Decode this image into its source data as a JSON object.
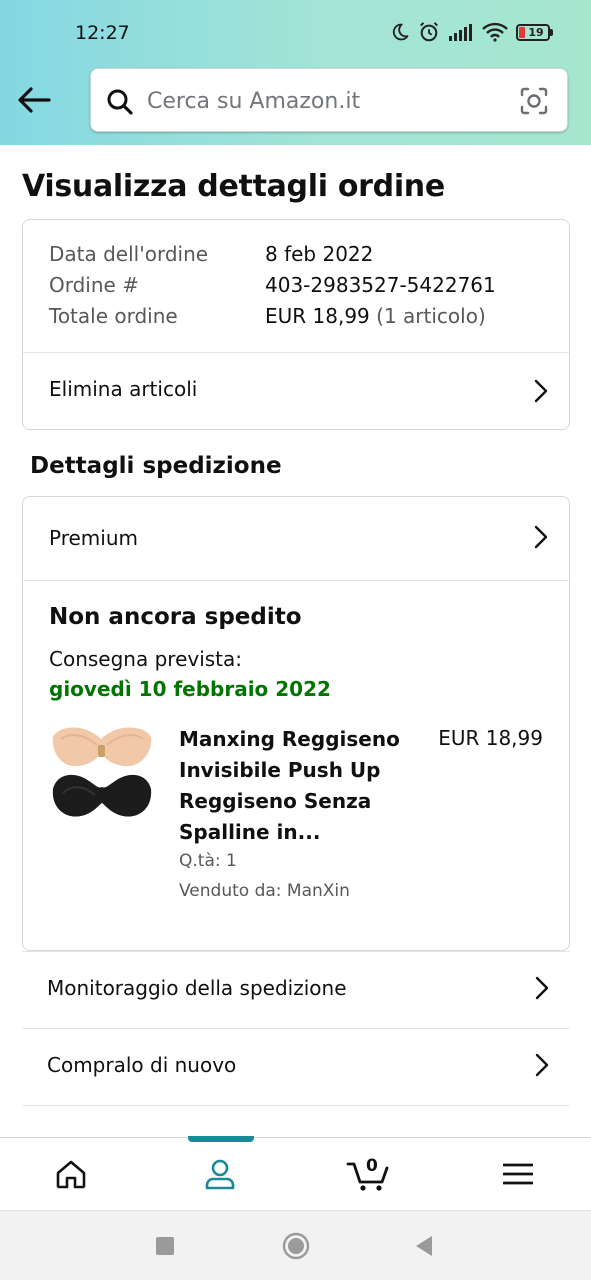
{
  "status_bar": {
    "time": "12:27",
    "battery_level": "19",
    "icons": [
      "moon-icon",
      "alarm-icon",
      "signal-icon",
      "wifi-icon",
      "battery-icon"
    ]
  },
  "header": {
    "back_icon": "arrow-left-icon",
    "search": {
      "placeholder": "Cerca su Amazon.it"
    },
    "colors": {
      "gradient_start": "#84d8e3",
      "gradient_end": "#a6e6cf"
    }
  },
  "page": {
    "title": "Visualizza dettagli ordine"
  },
  "order_summary": {
    "date_label": "Data dell'ordine",
    "date_value": "8 feb 2022",
    "number_label": "Ordine #",
    "number_value": "403-2983527-5422761",
    "total_label": "Totale ordine",
    "total_value": "EUR 18,99",
    "total_items": "(1 articolo)",
    "delete_items_label": "Elimina articoli"
  },
  "shipping": {
    "section_title": "Dettagli spedizione",
    "method_label": "Premium",
    "status": "Non ancora spedito",
    "delivery_label": "Consegna prevista:",
    "delivery_date": "giovedì 10 febbraio 2022",
    "delivery_color": "#007600",
    "product": {
      "title": "Manxing Reggiseno Invisibile Push Up Reggiseno Senza Spalline in...",
      "price": "EUR 18,99",
      "quantity": "Q.tà: 1",
      "seller": "Venduto da: ManXin"
    }
  },
  "actions": {
    "track": "Monitoraggio della spedizione",
    "buy_again": "Compralo di nuovo"
  },
  "bottom_nav": {
    "items": [
      "home-icon",
      "account-icon",
      "cart-icon",
      "menu-icon"
    ],
    "active": "account-icon",
    "cart_count": "0",
    "accent": "#1a8a99"
  },
  "system_nav": [
    "recents-icon",
    "home-circle-icon",
    "back-triangle-icon"
  ]
}
